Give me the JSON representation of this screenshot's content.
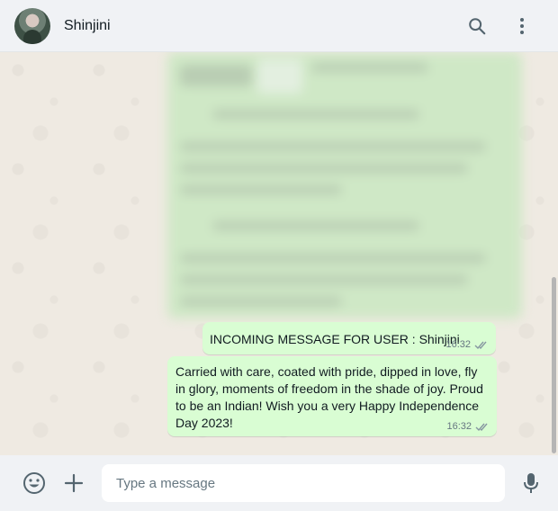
{
  "header": {
    "contact_name": "Shinjini",
    "search_icon": "search-icon",
    "menu_icon": "more-vertical-icon"
  },
  "messages": [
    {
      "text": "INCOMING MESSAGE FOR USER : Shinjini",
      "time": "16:32",
      "status": "double-check-icon"
    },
    {
      "text": "Carried with care, coated with pride, dipped in love, fly in glory, moments of freedom in the shade of joy. Proud to be an Indian! Wish you a very Happy Independence Day 2023!",
      "time": "16:32",
      "status": "double-check-icon"
    }
  ],
  "composer": {
    "placeholder": "Type a message",
    "value": "",
    "emoji_icon": "emoji-icon",
    "attach_icon": "plus-icon",
    "mic_icon": "mic-icon"
  },
  "colors": {
    "outgoing_bubble": "#d9fdd3",
    "header_bg": "#f0f2f5",
    "chat_bg": "#efeae2",
    "meta_text": "#667781",
    "read_check": "#8696a0"
  }
}
